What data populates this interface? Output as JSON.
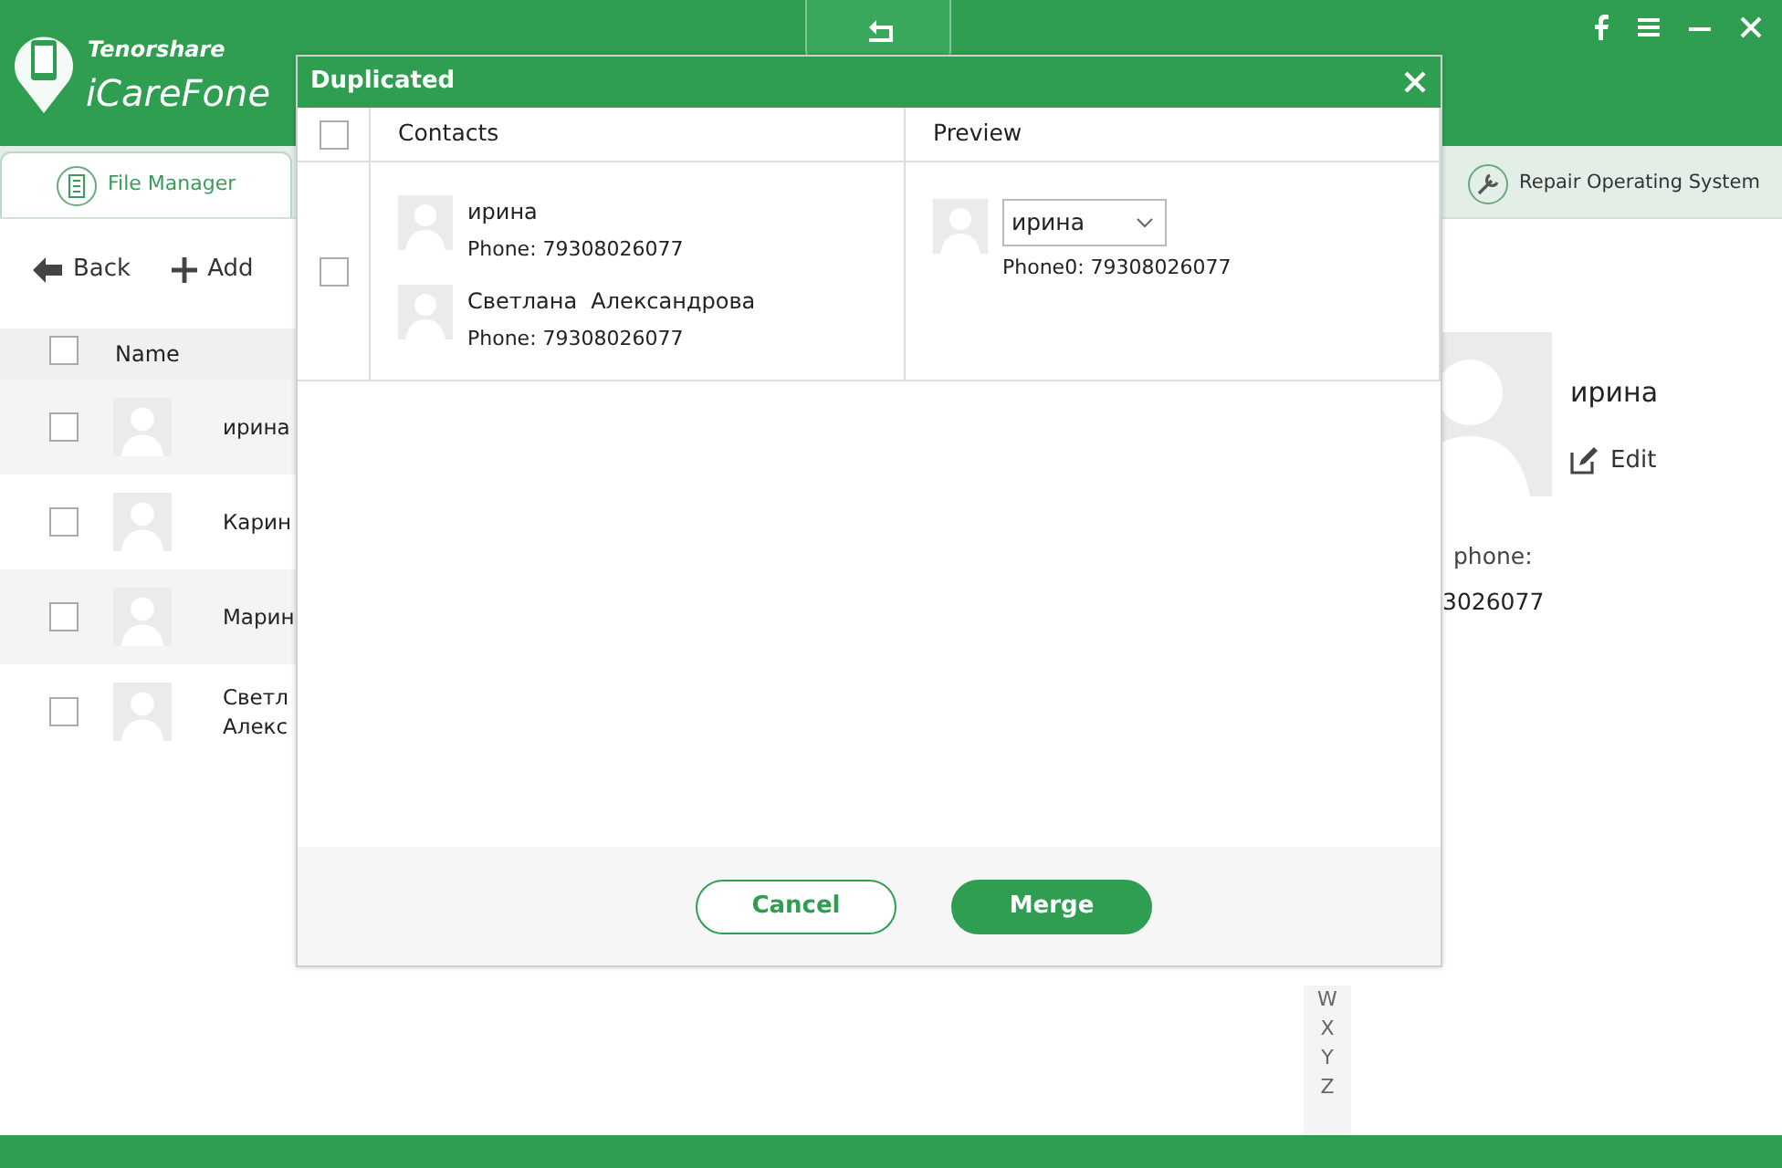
{
  "app": {
    "brand": "Tenorshare",
    "product": "iCareFone"
  },
  "tabs": [
    {
      "label": "File Manager",
      "selected": true
    },
    {
      "label": "Repair Operating System",
      "selected": false
    }
  ],
  "toolbar": [
    {
      "label": "Back",
      "kind": "back"
    },
    {
      "label": "Add",
      "kind": "add"
    }
  ],
  "list": {
    "column": "Name",
    "all_checked": false,
    "rows": [
      {
        "name": "ирина",
        "checked": false
      },
      {
        "name": "Карин",
        "checked": false
      },
      {
        "name": "Марин",
        "checked": false
      },
      {
        "name": "Светл\nАлекс",
        "checked": false
      }
    ]
  },
  "detail": {
    "name": "ирина",
    "edit": "Edit",
    "phone_label": "phone:",
    "phone": "3026077"
  },
  "index": [
    "W",
    "X",
    "Y",
    "Z"
  ],
  "dialog": {
    "title": "Duplicated",
    "all_checked": false,
    "columns": [
      "Contacts",
      "Preview"
    ],
    "groups": [
      {
        "checked": false,
        "contacts": [
          {
            "name": "ирина",
            "phone": "Phone: 79308026077"
          },
          {
            "name": "Светлана  Александрова",
            "phone": "Phone: 79308026077"
          }
        ],
        "preview": {
          "name": "ирина",
          "phone": "Phone0: 79308026077"
        }
      }
    ],
    "buttons": [
      {
        "label": "Cancel",
        "kind": "secondary"
      },
      {
        "label": "Merge",
        "kind": "primary"
      }
    ]
  }
}
